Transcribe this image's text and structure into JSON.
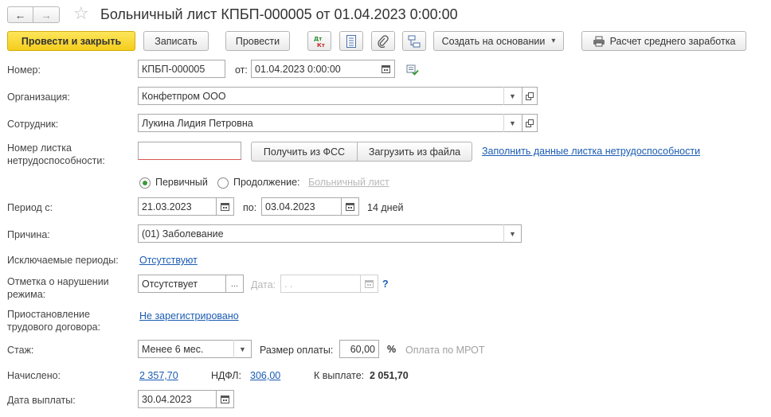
{
  "window": {
    "title": "Больничный лист КПБП-000005 от 01.04.2023 0:00:00",
    "back": "←",
    "forward": "→",
    "star": "☆"
  },
  "toolbar": {
    "post_and_close": "Провести и закрыть",
    "save": "Записать",
    "post": "Провести",
    "dtkt": "ДтКт",
    "create_based_on": "Создать на основании",
    "create_arrow": "▾",
    "average_earnings": "Расчет среднего заработка"
  },
  "form": {
    "number": {
      "label": "Номер:",
      "value": "КПБП-000005",
      "date_label": "от:",
      "date_value": "01.04.2023  0:00:00"
    },
    "organization": {
      "label": "Организация:",
      "value": "Конфетпром ООО"
    },
    "employee": {
      "label": "Сотрудник:",
      "value": "Лукина Лидия Петровна"
    },
    "sick_note": {
      "label_line1": "Номер листка",
      "label_line2": "нетрудоспособности:",
      "value": "",
      "get_fss": "Получить из ФСС",
      "load_file": "Загрузить из файла",
      "fill_link": "Заполнить данные листка нетрудоспособности"
    },
    "sheet_type": {
      "primary": "Первичный",
      "continuation": "Продолжение:",
      "continuation_link": "Больничный лист",
      "selected": "primary"
    },
    "period": {
      "label": "Период с:",
      "from": "21.03.2023",
      "to_label": "по:",
      "to": "03.04.2023",
      "days": "14 дней"
    },
    "reason": {
      "label": "Причина:",
      "value": "(01) Заболевание"
    },
    "excluded": {
      "label": "Исключаемые периоды:",
      "value": "Отсутствуют"
    },
    "violation": {
      "label_line1": "Отметка о нарушении",
      "label_line2": "режима:",
      "value": "Отсутствует",
      "ellipsis": "...",
      "date_label": "Дата:",
      "date_value": " .  .",
      "help": "?"
    },
    "suspension": {
      "label_line1": "Приостановление",
      "label_line2": "трудового договора:",
      "value": "Не зарегистрировано"
    },
    "experience": {
      "label": "Стаж:",
      "value": "Менее 6 мес.",
      "pay_size_label": "Размер оплаты:",
      "pay_size_value": "60,00",
      "percent": "%",
      "mrot_note": "Оплата по МРОТ"
    },
    "accrued": {
      "label": "Начислено:",
      "value": "2 357,70",
      "ndfl_label": "НДФЛ:",
      "ndfl_value": "306,00",
      "to_pay_label": "К выплате:",
      "to_pay_value": "2 051,70"
    },
    "pay_date": {
      "label": "Дата выплаты:",
      "value": "30.04.2023"
    }
  },
  "colors": {
    "primary_button": "#f4cd1d",
    "link": "#1b5cb3",
    "radio_selected": "#3b9a3b"
  }
}
